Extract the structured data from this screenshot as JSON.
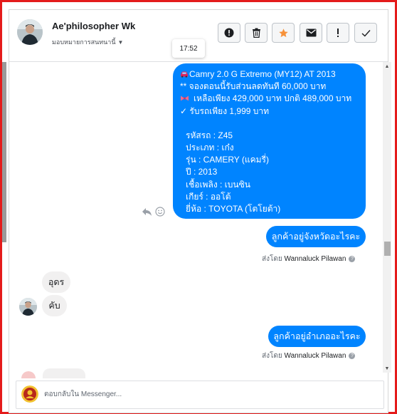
{
  "header": {
    "name": "Ae'philosopher Wk",
    "assign_label": "มอบหมายการสนทนานี้",
    "assign_caret": "▼"
  },
  "toolbar": {
    "buttons": [
      {
        "name": "spam",
        "icon": "alert-circle-icon"
      },
      {
        "name": "delete",
        "icon": "trash-icon"
      },
      {
        "name": "follow-up",
        "icon": "star-icon",
        "color": "#f7923a"
      },
      {
        "name": "unread",
        "icon": "envelope-icon"
      },
      {
        "name": "important",
        "icon": "exclamation-icon"
      },
      {
        "name": "done",
        "icon": "check-icon"
      }
    ]
  },
  "tooltip": {
    "time": "17:52"
  },
  "messages": {
    "listing": {
      "line1": "Camry 2.0 G Extremo (MY12) AT 2013",
      "line2": "** จองตอนนี้รับส่วนลดทันที 60,000 บาท",
      "line3": "เหลือเพียง 429,000 บาท ปกติ 489,000 บาท",
      "line4": "✓ รับรถเพียง 1,999 บาท",
      "spec1": "รหัสรถ : Z45",
      "spec2": "ประเภท : เก๋ง",
      "spec3": "รุ่น : CAMERY (แคมรี่)",
      "spec4": "ปี : 2013",
      "spec5": "เชื้อเพลิง : เบนซิน",
      "spec6": "เกียร์ : ออโต้",
      "spec7": "ยี่ห้อ : TOYOTA (โตโยต้า)"
    },
    "question_province": "ลูกค้าอยู่จังหวัดอะไรคะ",
    "question_district": "ลูกค้าอยู่อำเภออะไรคะ",
    "sent_by_prefix": "ส่งโดย",
    "sender": "Wannaluck Pilawan",
    "reply1": "อุดร",
    "reply2": "คับ"
  },
  "composer": {
    "placeholder": "ตอบกลับใน Messenger..."
  },
  "colors": {
    "accent": "#0084ff",
    "frame": "#e41b1b",
    "incoming_bubble": "#f1f0f0"
  }
}
